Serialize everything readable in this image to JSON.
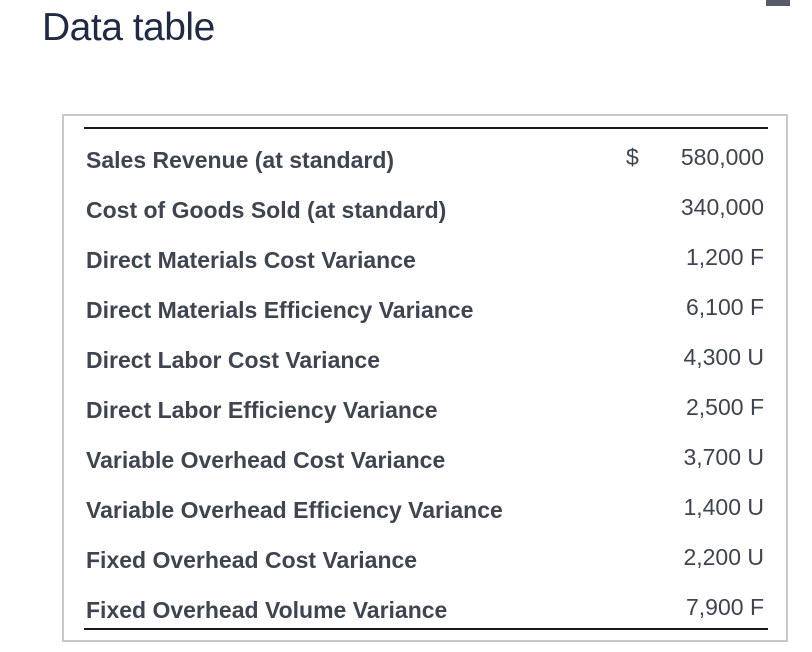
{
  "title": "Data table",
  "currency_symbol": "$",
  "rows": [
    {
      "label": "Sales Revenue (at standard)",
      "value": "580,000"
    },
    {
      "label": "Cost of Goods Sold (at standard)",
      "value": "340,000"
    },
    {
      "label": "Direct Materials Cost Variance",
      "value": "1,200 F"
    },
    {
      "label": "Direct Materials Efficiency Variance",
      "value": "6,100 F"
    },
    {
      "label": "Direct Labor Cost Variance",
      "value": "4,300 U"
    },
    {
      "label": "Direct Labor Efficiency Variance",
      "value": "2,500 F"
    },
    {
      "label": "Variable Overhead Cost Variance",
      "value": "3,700 U"
    },
    {
      "label": "Variable Overhead Efficiency Variance",
      "value": "1,400 U"
    },
    {
      "label": "Fixed Overhead Cost Variance",
      "value": "2,200 U"
    },
    {
      "label": "Fixed Overhead Volume Variance",
      "value": "7,900 F"
    }
  ]
}
